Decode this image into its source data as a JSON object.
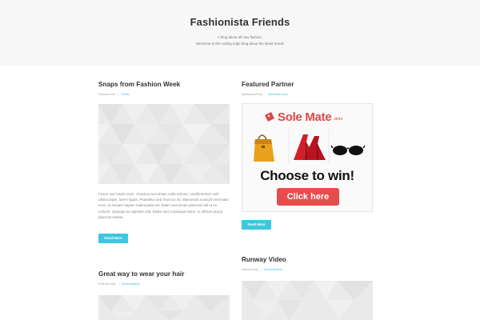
{
  "site": {
    "title": "Fashionista Friends",
    "tagline_line1": "A blog about all new fashion.",
    "tagline_line2": "Welcome to the cutting edge blog about the latest trends"
  },
  "posts": [
    {
      "title": "Snaps from Fashion Week",
      "meta_author": "Frances Doe",
      "meta_sep": "•",
      "meta_category": "Trends",
      "excerpt": "Fusce non turpis enim. Vivamus accumsan nulla sciletur, condimentum velit ullamcorper, lorem ligula. Phasellus sed rhoncus mi. Maecenas suscipit venenatis eros, at semper sapien malesuada vel. Etiam accumsan placerat nisl ut ex vulnum. Quisque ac egestas mla. Etiam sed consequat dolor. In ultrices purus placerat massa.",
      "button_label": "Read More"
    },
    {
      "title": "Great way to wear your hair",
      "meta_author": "Pretl ces Doe",
      "meta_sep": "•",
      "meta_category": "Demonstration"
    }
  ],
  "sidebar": {
    "featured": {
      "title": "Featured Partner",
      "meta_author": "Sponsored Post",
      "meta_sep": "•",
      "meta_category": "Sole Mate store",
      "button_label": "Read More"
    },
    "ad": {
      "brand": "Sole Mate",
      "brand_suffix": "store",
      "headline": "Choose to win!",
      "cta": "Click here",
      "accent_color": "#e74c4c"
    },
    "video": {
      "title": "Runway Video",
      "meta_author": "Frances Doe",
      "meta_sep": "•",
      "meta_category": "Demonstration"
    }
  },
  "colors": {
    "accent": "#3ec7de",
    "header_bg": "#f7f7f7"
  }
}
